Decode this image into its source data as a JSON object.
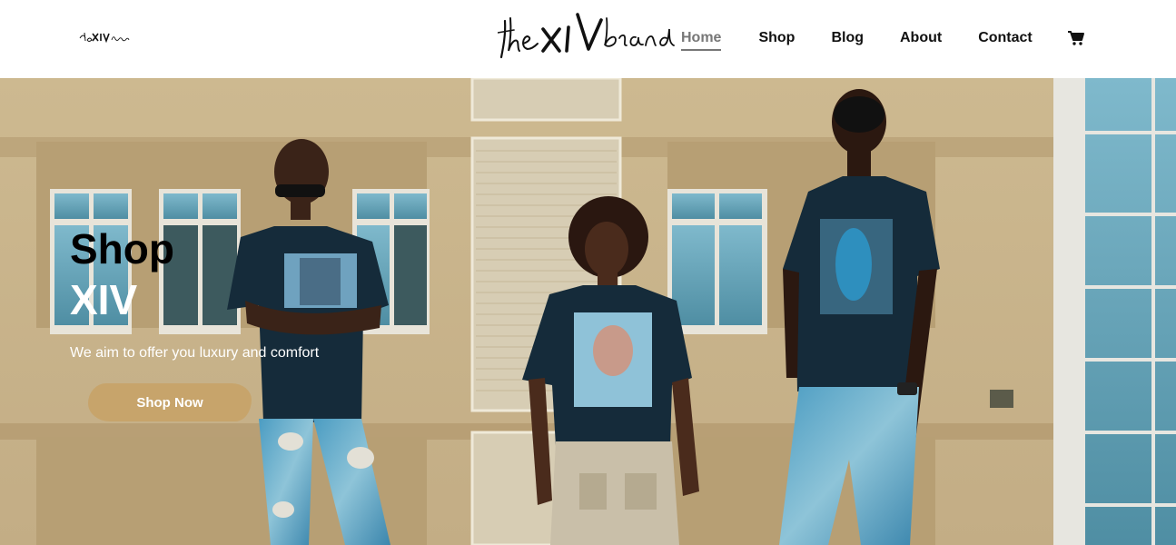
{
  "header": {
    "logo_small_text": "theXIVbrand",
    "logo_main_text": "the XIV brand",
    "nav": [
      {
        "label": "Home",
        "active": true
      },
      {
        "label": "Shop",
        "active": false
      },
      {
        "label": "Blog",
        "active": false
      },
      {
        "label": "About",
        "active": false
      },
      {
        "label": "Contact",
        "active": false
      }
    ],
    "cart_icon": "cart-icon"
  },
  "hero": {
    "title_line1": "Shop",
    "title_line2": "XIV",
    "tagline": "We aim to offer you luxury and comfort",
    "cta_label": "Shop Now",
    "cta_color": "#c7a46b",
    "image_description": "three models in dark graphic tees in front of a beige building"
  }
}
